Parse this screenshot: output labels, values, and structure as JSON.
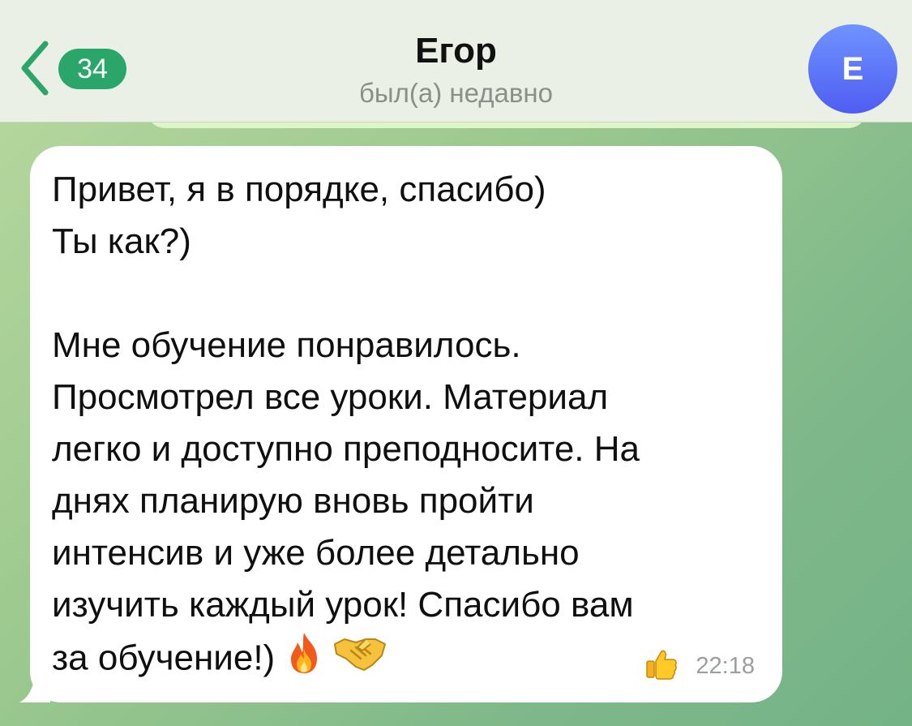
{
  "header": {
    "unread_count": "34",
    "contact_name": "Егор",
    "status": "был(а) недавно",
    "avatar_letter": "Е"
  },
  "message": {
    "lines": [
      "Привет, я в порядке, спасибо)",
      "Ты как?)",
      "",
      "Мне обучение понравилось.",
      "Просмотрел все уроки. Материал",
      "легко и доступно преподносите. На",
      "днях планирую вновь пройти",
      "интенсив и уже более детально",
      "изучить каждый урок!  Спасибо вам",
      "за обучение!)"
    ],
    "emojis": [
      "fire-icon",
      "handshake-icon"
    ],
    "reaction": "thumbs-up-icon",
    "time": "22:18"
  },
  "colors": {
    "header_bg": "#eaf0e6",
    "accent_green": "#2aa66a",
    "avatar_blue": "#5a6ff5",
    "bubble_bg": "#ffffff"
  }
}
